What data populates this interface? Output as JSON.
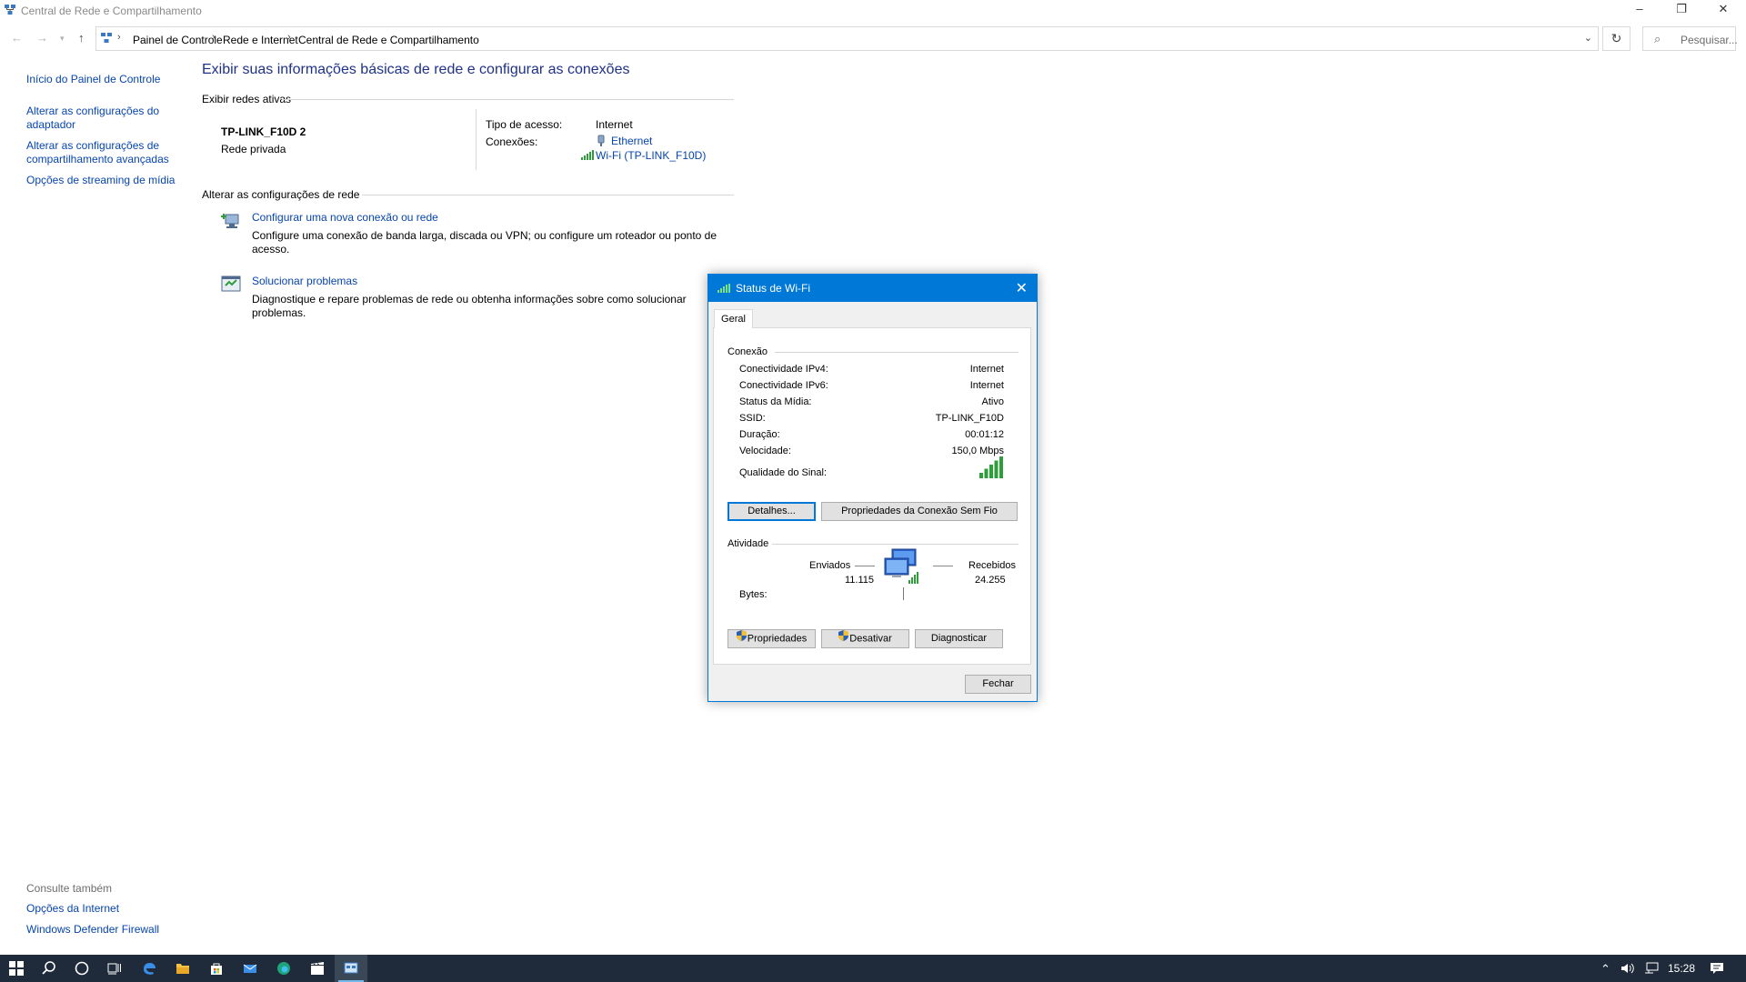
{
  "window": {
    "title": "Central de Rede e Compartilhamento",
    "controls": {
      "minimize": "–",
      "restore": "❐",
      "close": "✕"
    }
  },
  "address_bar": {
    "breadcrumbs": [
      "Painel de Controle",
      "Rede e Internet",
      "Central de Rede e Compartilhamento"
    ],
    "search_placeholder": "Pesquisar..."
  },
  "left_pane": {
    "links": [
      "Início do Painel de Controle",
      "Alterar as configurações do adaptador",
      "Alterar as configurações de compartilhamento avançadas",
      "Opções de streaming de mídia"
    ],
    "see_also_heading": "Consulte também",
    "see_also_links": [
      "Opções da Internet",
      "Windows Defender Firewall"
    ]
  },
  "main": {
    "title": "Exibir suas informações básicas de rede e configurar as conexões",
    "active_networks_heading": "Exibir redes ativas",
    "network": {
      "name": "TP-LINK_F10D 2",
      "type": "Rede privada",
      "access_type_label": "Tipo de acesso:",
      "access_type_value": "Internet",
      "connections_label": "Conexões:",
      "connections": [
        "Ethernet",
        "Wi-Fi (TP-LINK_F10D)"
      ]
    },
    "change_settings_heading": "Alterar as configurações de rede",
    "tasks": [
      {
        "title": "Configurar uma nova conexão ou rede",
        "description": "Configure uma conexão de banda larga, discada ou VPN; ou configure um roteador ou ponto de acesso."
      },
      {
        "title": "Solucionar problemas",
        "description": "Diagnostique e repare problemas de rede ou obtenha informações sobre como solucionar problemas."
      }
    ]
  },
  "dialog": {
    "title": "Status de Wi-Fi",
    "tab": "Geral",
    "connection_heading": "Conexão",
    "rows": [
      {
        "label": "Conectividade IPv4:",
        "value": "Internet"
      },
      {
        "label": "Conectividade IPv6:",
        "value": "Internet"
      },
      {
        "label": "Status da Mídia:",
        "value": "Ativo"
      },
      {
        "label": "SSID:",
        "value": "TP-LINK_F10D"
      },
      {
        "label": "Duração:",
        "value": "00:01:12"
      },
      {
        "label": "Velocidade:",
        "value": "150,0 Mbps"
      }
    ],
    "signal_label": "Qualidade do Sinal:",
    "signal_bars": 5,
    "details_button": "Detalhes...",
    "wireless_props_button": "Propriedades da Conexão Sem Fio",
    "activity_heading": "Atividade",
    "sent_label": "Enviados",
    "received_label": "Recebidos",
    "bytes_label": "Bytes:",
    "bytes_sent": "11.115",
    "bytes_received": "24.255",
    "properties_button": "Propriedades",
    "disable_button": "Desativar",
    "diagnose_button": "Diagnosticar",
    "close_button": "Fechar"
  },
  "taskbar": {
    "clock": "15:28"
  },
  "colors": {
    "link": "#0645ad",
    "title_blue": "#1e3287",
    "accent": "#0078d7",
    "taskbar": "#1f2b3a",
    "signal_green": "#2e9e3a"
  }
}
